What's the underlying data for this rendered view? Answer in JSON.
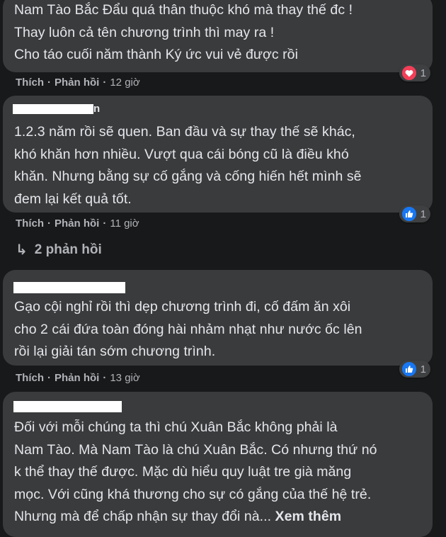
{
  "comments": [
    {
      "text_lines": [
        "Nam Tào Bắc Đẩu quá thân thuộc khó mà thay thế đc !",
        "Thay luôn cả tên chương trình thì may ra !",
        "Cho táo cuối năm thành Ký ức vui vẻ được rồi"
      ],
      "like_label": "Thích",
      "reply_label": "Phản hồi",
      "time": "12 giờ",
      "reaction": "heart",
      "reaction_count": "1"
    },
    {
      "author_tail": "n",
      "text_lines": [
        "1.2.3 năm rồi sẽ quen. Ban đầu và sự thay thế sẽ khác,",
        "khó khăn hơn nhiều. Vượt qua cái bóng cũ là điều khó",
        "khăn. Nhưng bằng sự cố gắng và cống hiến hết mình sẽ",
        "đem lại kết quả tốt."
      ],
      "like_label": "Thích",
      "reply_label": "Phản hồi",
      "time": "11 giờ",
      "reaction": "like",
      "reaction_count": "1",
      "replies_label": "2 phản hồi"
    },
    {
      "text_lines": [
        "Gạo cội nghỉ rồi thì dẹp chương trình đi, cố đấm ăn xôi",
        "cho 2 cái đứa toàn đóng hài nhảm nhạt như nước ốc lên",
        "rồi lại giải tán sớm chương trình."
      ],
      "like_label": "Thích",
      "reply_label": "Phản hồi",
      "time": "13 giờ",
      "reaction": "like",
      "reaction_count": "1"
    },
    {
      "text_lines": [
        "Đối với mỗi chúng ta thì chú Xuân Bắc không phải là",
        "Nam Tào. Mà Nam Tào là chú Xuân Bắc. Có nhưng thứ nó",
        "k thể thay thế được. Mặc dù hiểu quy luật tre già măng",
        "mọc. Với cũng khá thương cho sự có gắng của thế hệ trẻ.",
        "Nhưng mà để chấp nhận sự thay đổi nà..."
      ],
      "see_more": "Xem thêm"
    }
  ],
  "colors": {
    "background": "#18191a",
    "bubble": "#3a3b3c",
    "text": "#e4e6eb",
    "meta": "#b0b3b8",
    "heart": "#f33e58",
    "like": "#1877f2"
  }
}
